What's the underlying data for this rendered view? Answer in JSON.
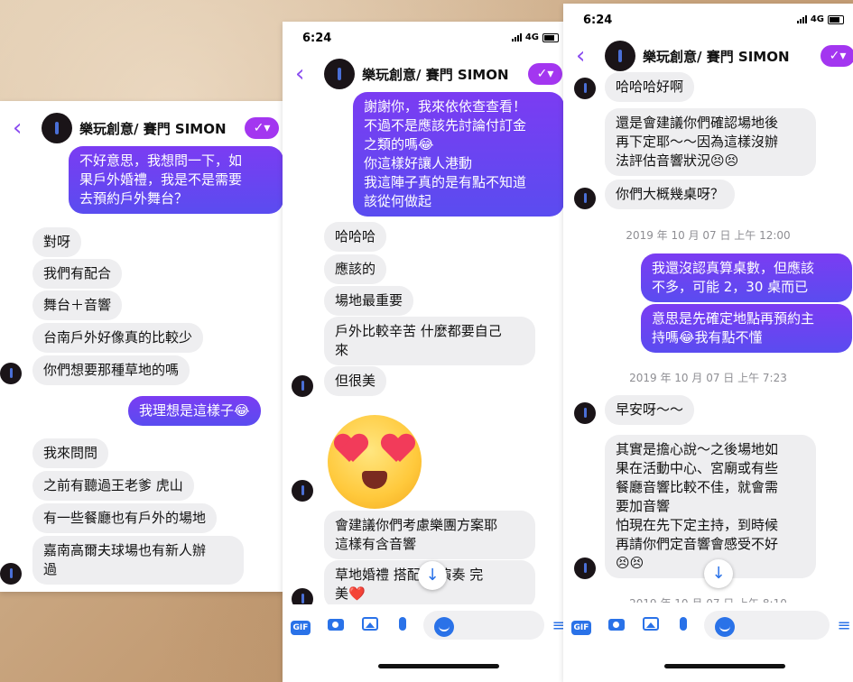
{
  "contact_name": "樂玩創意/ 賽門 SIMON",
  "status": {
    "time": "6:24",
    "network": "4G"
  },
  "composer": {
    "gif": "GIF",
    "placeholder": "Aa"
  },
  "screen1": {
    "out1": [
      "不好意思，我想問一下，如",
      "果戶外婚禮，我是不是需要",
      "去預約戶外舞台？"
    ],
    "in": [
      "對呀",
      "我們有配合",
      "舞台＋音響",
      "台南戶外好像真的比較少",
      "你們想要那種草地的嗎"
    ],
    "out2": "我理想是這樣子😂",
    "in2": [
      "我來問問",
      "之前有聽過王老爹 虎山",
      "有一些餐廳也有戶外的場地"
    ],
    "in3": [
      "嘉南高爾夫球場也有新人辦",
      "過"
    ]
  },
  "screen2": {
    "out1": [
      "謝謝你，我來依依查查看！",
      "不過不是應該先討論付訂金",
      "之類的嗎😂",
      "你這樣好讓人港動",
      "我這陣子真的是有點不知道",
      "該從何做起"
    ],
    "in": [
      "哈哈哈",
      "應該的",
      "場地最重要"
    ],
    "in2": [
      "戶外比較辛苦 什麼都要自己",
      "來"
    ],
    "in3": "但很美",
    "in4": [
      "會建議你們考慮樂團方案耶",
      "這樣有含音響"
    ],
    "in5": [
      "草地婚禮 搭配  場演奏 完",
      "美❤️"
    ]
  },
  "screen3": {
    "in0": "哈哈哈好啊",
    "in1": [
      "還是會建議你們確認場地後",
      "再下定耶～～因為這樣沒辦",
      "法評估音響狀況😣😣"
    ],
    "in2": "你們大概幾桌呀？",
    "stamp1": "2019 年 10 月 07 日 上午 12:00",
    "out1": [
      "我還沒認真算桌數，但應該",
      "不多，可能 2，30 桌而已"
    ],
    "out2": [
      "意思是先確定地點再預約主",
      "持嗎😂我有點不懂"
    ],
    "stamp2": "2019 年 10 月 07 日 上午 7:23",
    "in3": "早安呀～～",
    "in4": [
      "其實是擔心說～之後場地如",
      "果在活動中心、宮廟或有些",
      "餐廳音響比較不佳，就會需",
      "要加音響",
      "怕現在先下定主持，到時候",
      "再請你們定音響會感受不好",
      "😣😣"
    ],
    "stamp3": "2019 年 10 月 07 日 上午 8:10"
  }
}
